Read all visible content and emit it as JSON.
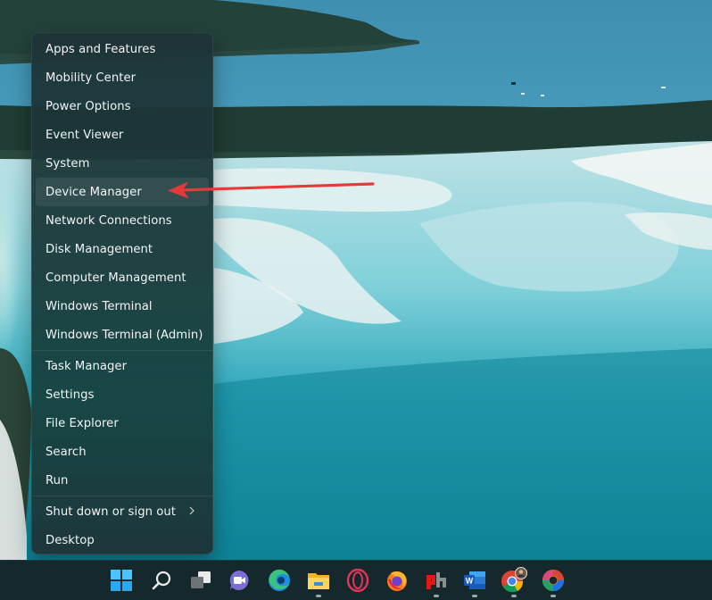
{
  "wallpaper": {
    "description": "Aerial view of tropical inlet with white sand swirls, turquoise water and forested islands",
    "colors": {
      "sea": "#3d93b4",
      "forest": "#1f3f36",
      "sand": "#e4ecec",
      "shallow": "#39b0c1",
      "deep": "#0f8499"
    }
  },
  "context_menu": {
    "groups": [
      [
        {
          "label": "Apps and Features"
        },
        {
          "label": "Mobility Center"
        },
        {
          "label": "Power Options"
        },
        {
          "label": "Event Viewer"
        },
        {
          "label": "System"
        },
        {
          "label": "Device Manager",
          "highlighted": true
        },
        {
          "label": "Network Connections"
        },
        {
          "label": "Disk Management"
        },
        {
          "label": "Computer Management"
        },
        {
          "label": "Windows Terminal"
        },
        {
          "label": "Windows Terminal (Admin)"
        }
      ],
      [
        {
          "label": "Task Manager"
        },
        {
          "label": "Settings"
        },
        {
          "label": "File Explorer"
        },
        {
          "label": "Search"
        },
        {
          "label": "Run"
        }
      ],
      [
        {
          "label": "Shut down or sign out",
          "submenu": true,
          "icon": "chevron-right-icon"
        },
        {
          "label": "Desktop"
        }
      ]
    ]
  },
  "annotation": {
    "type": "arrow",
    "color": "#e8393a",
    "points_to": "Device Manager"
  },
  "taskbar": {
    "icons": [
      {
        "name": "start-icon",
        "running": false
      },
      {
        "name": "search-icon",
        "running": false
      },
      {
        "name": "task-view-icon",
        "running": false
      },
      {
        "name": "teams-chat-icon",
        "running": false
      },
      {
        "name": "edge-icon",
        "running": false
      },
      {
        "name": "file-explorer-icon",
        "running": true
      },
      {
        "name": "opera-gx-icon",
        "running": false
      },
      {
        "name": "firefox-icon",
        "running": false
      },
      {
        "name": "ph-app-icon",
        "running": true
      },
      {
        "name": "word-icon",
        "running": true
      },
      {
        "name": "chrome-profile-icon",
        "running": true
      },
      {
        "name": "edge-canary-icon",
        "running": true
      }
    ]
  }
}
